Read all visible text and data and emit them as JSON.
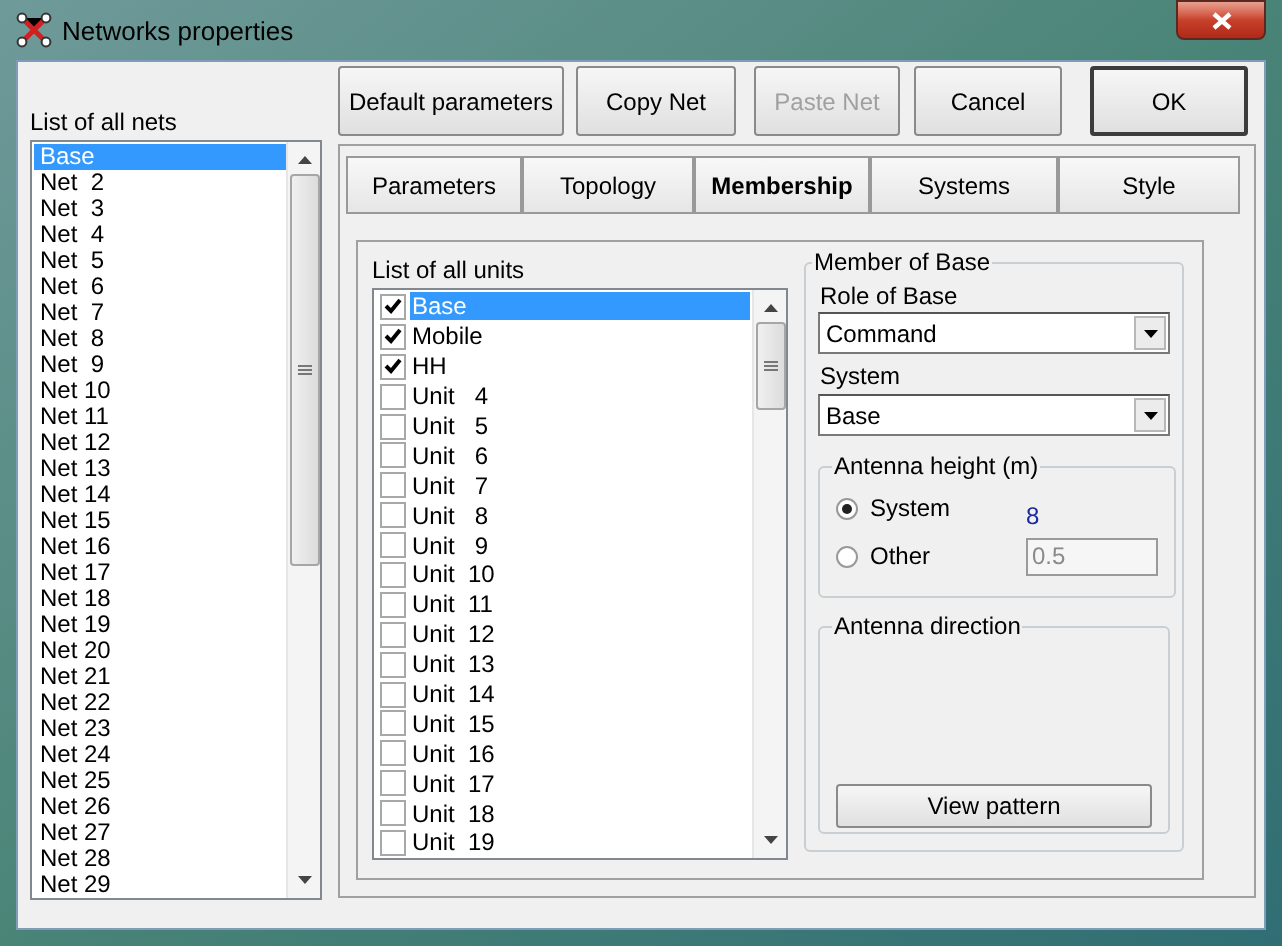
{
  "window": {
    "title": "Networks properties"
  },
  "nets": {
    "label": "List of all nets",
    "items": [
      {
        "label": "Base",
        "selected": true
      },
      {
        "label": "Net  2",
        "selected": false
      },
      {
        "label": "Net  3",
        "selected": false
      },
      {
        "label": "Net  4",
        "selected": false
      },
      {
        "label": "Net  5",
        "selected": false
      },
      {
        "label": "Net  6",
        "selected": false
      },
      {
        "label": "Net  7",
        "selected": false
      },
      {
        "label": "Net  8",
        "selected": false
      },
      {
        "label": "Net  9",
        "selected": false
      },
      {
        "label": "Net 10",
        "selected": false
      },
      {
        "label": "Net 11",
        "selected": false
      },
      {
        "label": "Net 12",
        "selected": false
      },
      {
        "label": "Net 13",
        "selected": false
      },
      {
        "label": "Net 14",
        "selected": false
      },
      {
        "label": "Net 15",
        "selected": false
      },
      {
        "label": "Net 16",
        "selected": false
      },
      {
        "label": "Net 17",
        "selected": false
      },
      {
        "label": "Net 18",
        "selected": false
      },
      {
        "label": "Net 19",
        "selected": false
      },
      {
        "label": "Net 20",
        "selected": false
      },
      {
        "label": "Net 21",
        "selected": false
      },
      {
        "label": "Net 22",
        "selected": false
      },
      {
        "label": "Net 23",
        "selected": false
      },
      {
        "label": "Net 24",
        "selected": false
      },
      {
        "label": "Net 25",
        "selected": false
      },
      {
        "label": "Net 26",
        "selected": false
      },
      {
        "label": "Net 27",
        "selected": false
      },
      {
        "label": "Net 28",
        "selected": false
      },
      {
        "label": "Net 29",
        "selected": false
      }
    ]
  },
  "buttons": [
    {
      "label": "Default parameters",
      "disabled": false,
      "default": false
    },
    {
      "label": "Copy Net",
      "disabled": false,
      "default": false
    },
    {
      "label": "Paste Net",
      "disabled": true,
      "default": false
    },
    {
      "label": "Cancel",
      "disabled": false,
      "default": false
    },
    {
      "label": "OK",
      "disabled": false,
      "default": true
    }
  ],
  "tabs": [
    {
      "label": "Parameters",
      "selected": false
    },
    {
      "label": "Topology",
      "selected": false
    },
    {
      "label": "Membership",
      "selected": true
    },
    {
      "label": "Systems",
      "selected": false
    },
    {
      "label": "Style",
      "selected": false
    }
  ],
  "units": {
    "label": "List of all units",
    "items": [
      {
        "label": "Base",
        "checked": true,
        "selected": true
      },
      {
        "label": "Mobile",
        "checked": true,
        "selected": false
      },
      {
        "label": "HH",
        "checked": true,
        "selected": false
      },
      {
        "label": "Unit   4",
        "checked": false,
        "selected": false
      },
      {
        "label": "Unit   5",
        "checked": false,
        "selected": false
      },
      {
        "label": "Unit   6",
        "checked": false,
        "selected": false
      },
      {
        "label": "Unit   7",
        "checked": false,
        "selected": false
      },
      {
        "label": "Unit   8",
        "checked": false,
        "selected": false
      },
      {
        "label": "Unit   9",
        "checked": false,
        "selected": false
      },
      {
        "label": "Unit  10",
        "checked": false,
        "selected": false
      },
      {
        "label": "Unit  11",
        "checked": false,
        "selected": false
      },
      {
        "label": "Unit  12",
        "checked": false,
        "selected": false
      },
      {
        "label": "Unit  13",
        "checked": false,
        "selected": false
      },
      {
        "label": "Unit  14",
        "checked": false,
        "selected": false
      },
      {
        "label": "Unit  15",
        "checked": false,
        "selected": false
      },
      {
        "label": "Unit  16",
        "checked": false,
        "selected": false
      },
      {
        "label": "Unit  17",
        "checked": false,
        "selected": false
      },
      {
        "label": "Unit  18",
        "checked": false,
        "selected": false
      },
      {
        "label": "Unit  19",
        "checked": false,
        "selected": false
      }
    ]
  },
  "member": {
    "title": "Member of Base",
    "role_label": "Role of Base",
    "role": "Command",
    "system_label": "System",
    "system": "Base",
    "antenna_height": {
      "title": "Antenna height (m)",
      "options": [
        {
          "label": "System",
          "selected": true,
          "kind": "text",
          "value": "8"
        },
        {
          "label": "Other",
          "selected": false,
          "kind": "field",
          "value": "0.5"
        }
      ]
    },
    "antenna_direction": {
      "title": "Antenna direction",
      "button": "View pattern"
    }
  }
}
